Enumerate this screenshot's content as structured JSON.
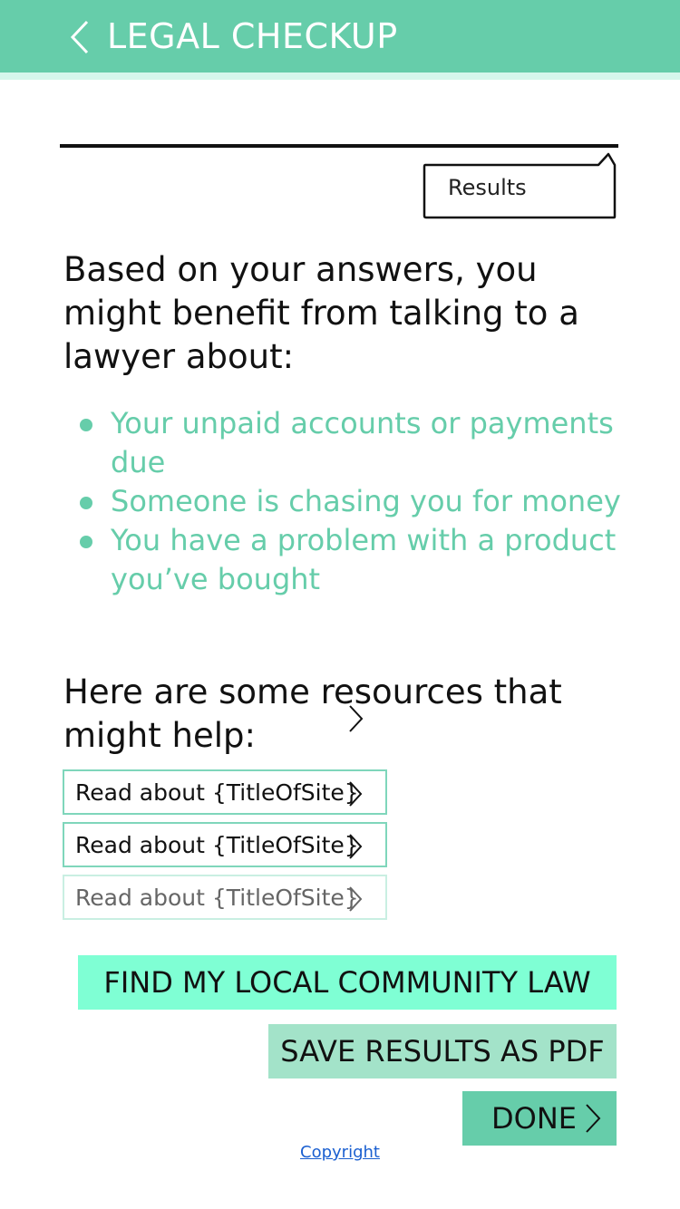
{
  "header": {
    "title": "LEGAL CHECKUP",
    "back_icon": "chevron-left-icon"
  },
  "progress": {
    "step_label": "Results"
  },
  "results": {
    "intro": "Based on your answers, you might benefit from talking to a lawyer about:",
    "issues": [
      "Your unpaid accounts or payments due",
      "Someone is chasing you for money",
      "You have a problem with a product you’ve bought"
    ]
  },
  "resources": {
    "heading": "Here are some resources that might help:",
    "links": [
      {
        "label": "Read about {TitleOfSite}",
        "icon": "chevron-right-icon"
      },
      {
        "label": "Read about {TitleOfSite}",
        "icon": "chevron-right-icon"
      },
      {
        "label": "Read about {TitleOfSite}",
        "icon": "chevron-right-icon"
      }
    ]
  },
  "actions": {
    "community_law": "FIND MY LOCAL COMMUNITY LAW",
    "save_pdf": "SAVE RESULTS AS PDF",
    "done": "DONE"
  },
  "footer": {
    "copyright": "Copyright"
  },
  "colors": {
    "header": "#66cdaa",
    "accent_text": "#66cdaa",
    "community_button": "#7fffd4",
    "pdf_button": "#a3e3c9",
    "done_button": "#66cdaa",
    "link": "#1a5fd0"
  }
}
